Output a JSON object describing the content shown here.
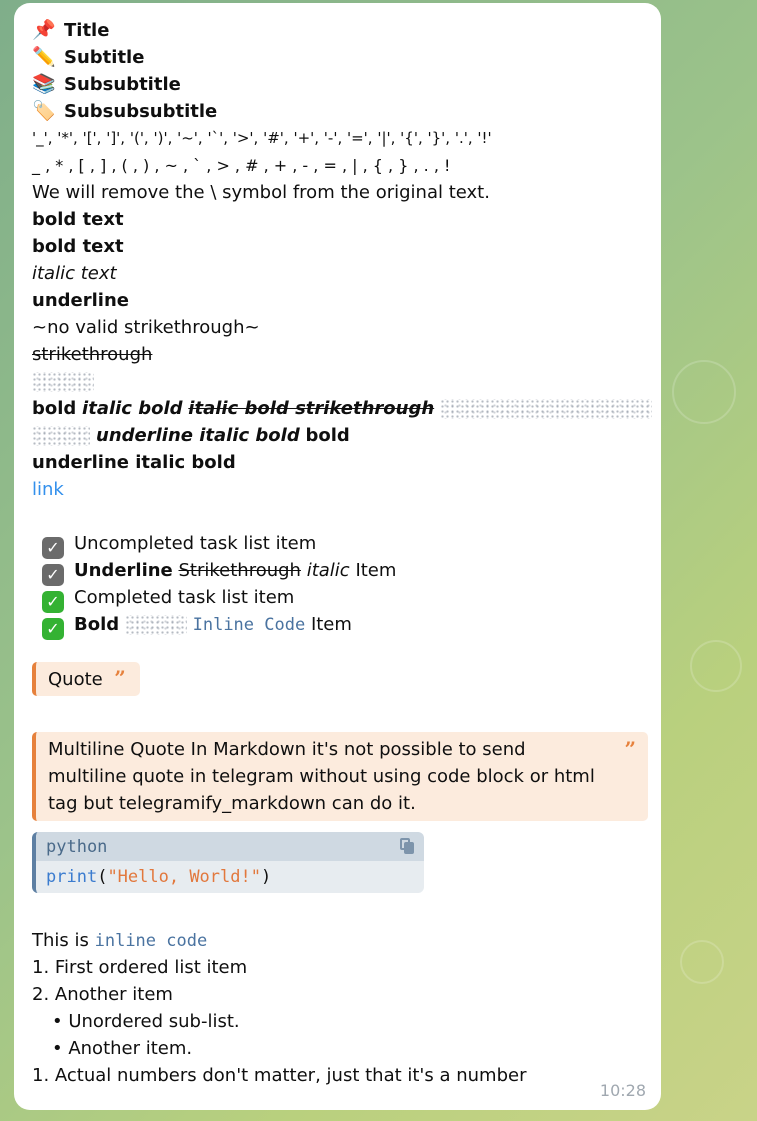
{
  "message": {
    "heading1": "Title",
    "heading2": "Subtitle",
    "heading3": "Subsubtitle",
    "heading4": "Subsubsubtitle",
    "icons": {
      "h1": "pushpin-icon",
      "h2": "pencil-icon",
      "h3": "books-icon",
      "h4": "tag-icon"
    },
    "escaped_quoted": "'_', '*', '[', ']', '(', ')', '~', '`', '>', '#', '+', '-', '=', '|', '{', '}', '.', '!'",
    "escaped_plain": "_ , * , [ , ] , ( , ) , ~ , ` , > , # , + , - , = , | , { , } , . , !",
    "remove_note": "We will remove the \\ symbol from the original text.",
    "bold1": "bold text",
    "bold2": "bold text",
    "italic": "italic text",
    "underline": "underline",
    "no_strike": "~no valid strikethrough~",
    "strike": "strikethrough",
    "mixed": {
      "bold": "bold",
      "italic_bold": "italic bold",
      "italic_bold_strike": "italic bold strikethrough",
      "underline_italic_bold": "underline italic bold",
      "bold_end": "bold"
    },
    "underline_italic_bold_line": "underline italic bold",
    "link": "link",
    "tasks": [
      {
        "label": "Uncompleted task list item",
        "state": "unchecked"
      },
      {
        "underline": "Underline",
        "strike": "Strikethrough",
        "italic": "italic",
        "tail": "Item",
        "state": "unchecked"
      },
      {
        "label": "Completed task list item",
        "state": "checked"
      },
      {
        "bold": "Bold",
        "code": "Inline Code",
        "tail": "Item",
        "state": "checked"
      }
    ],
    "quote": "Quote",
    "quote_mark": "”",
    "multiline_quote": "Multiline Quote In Markdown it's not possible to send multiline quote in telegram without using code block or html tag but telegramify_markdown can do it.",
    "code_block": {
      "language": "python",
      "func": "print",
      "open": "(",
      "string": "\"Hello, World!\"",
      "close": ")"
    },
    "inline_code_prefix": "This is ",
    "inline_code": "inline code",
    "list": {
      "item1": "1. First ordered list item",
      "item2": "2. Another item",
      "sub1": "• Unordered sub-list.",
      "sub2": "• Another item.",
      "item3": "1. Actual numbers don't matter, just that it's a number"
    },
    "time": "10:28"
  },
  "colors": {
    "link": "#3390ec",
    "quote_accent": "#e6813c",
    "quote_bg": "#fcebdd",
    "code_accent": "#5d7fa3",
    "check_green": "#34b233",
    "check_gray": "#6b6b6b"
  }
}
